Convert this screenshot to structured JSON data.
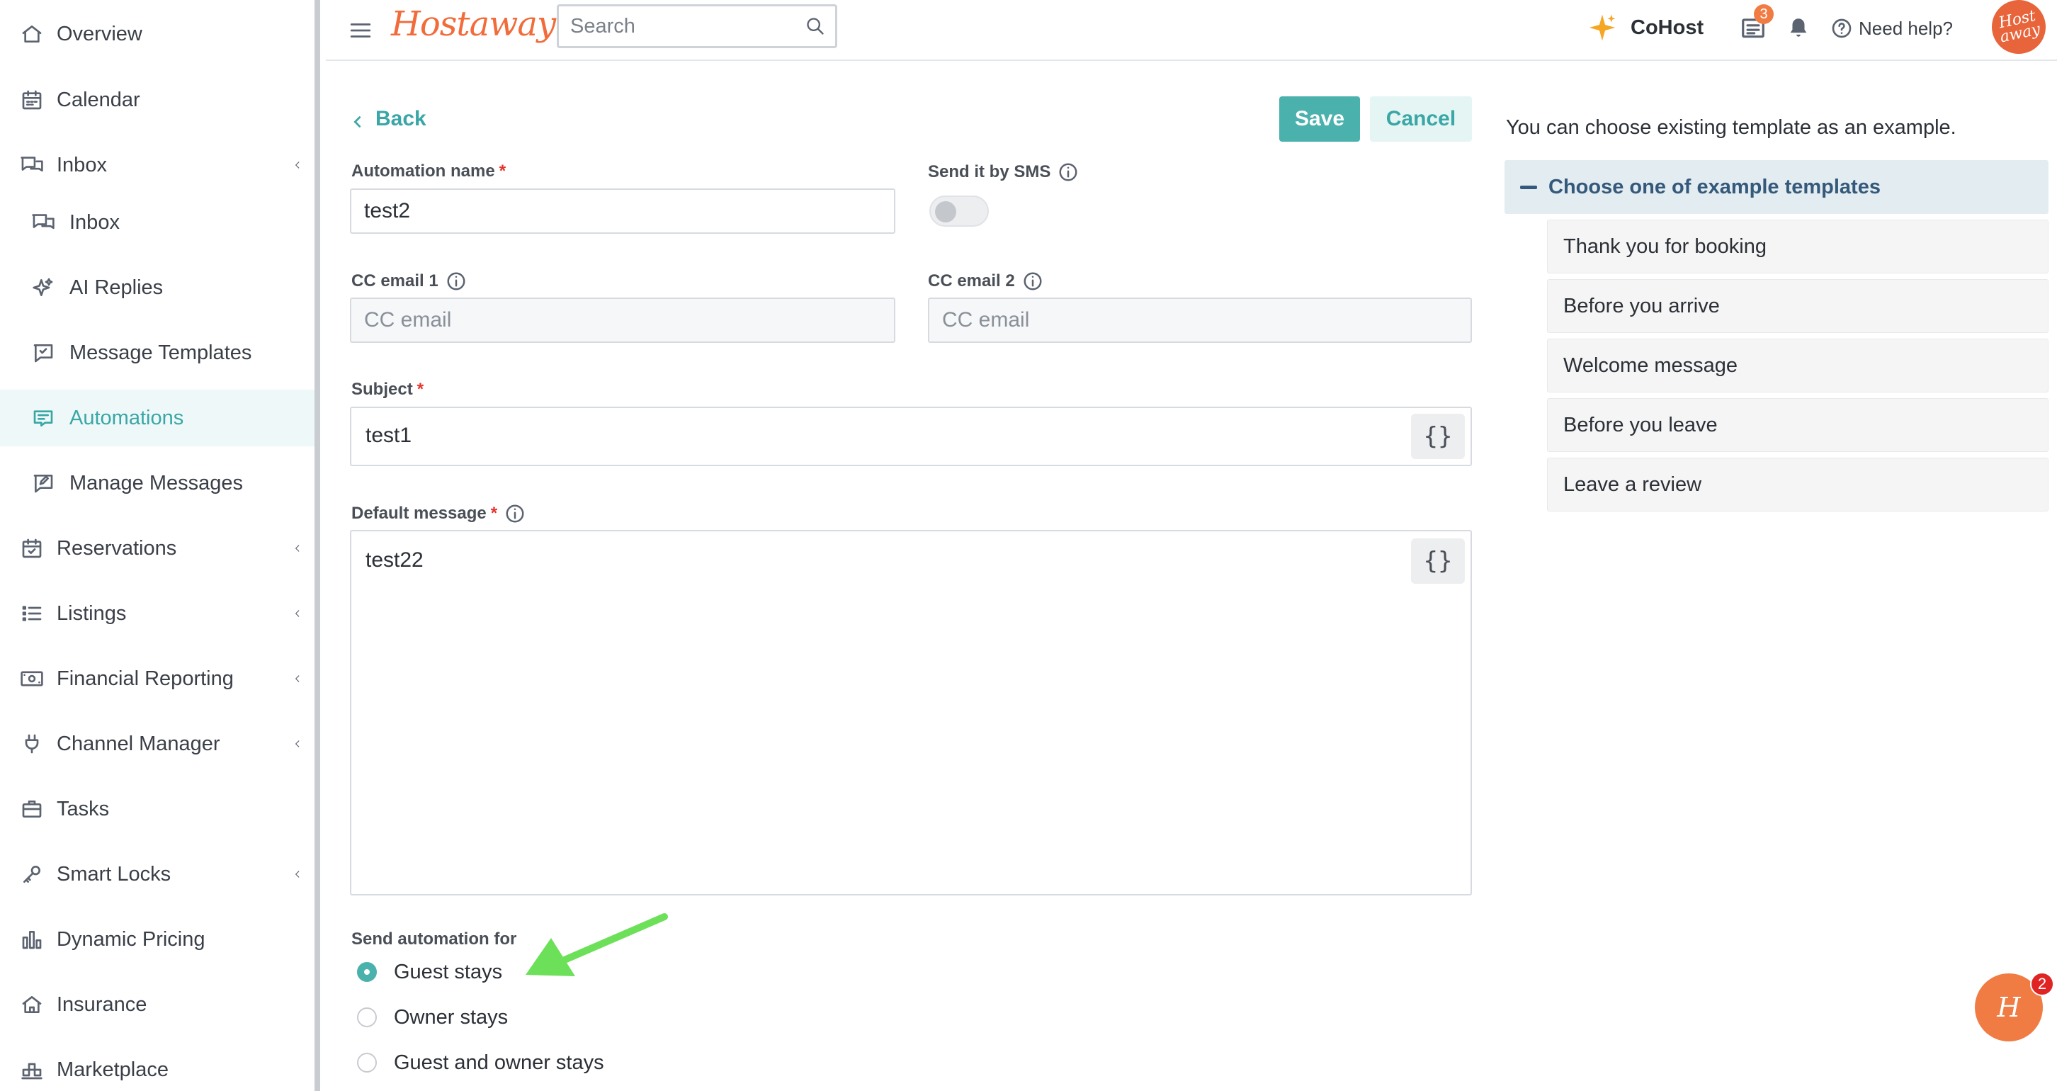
{
  "sidebar": {
    "items": [
      {
        "label": "Overview",
        "icon": "home-icon"
      },
      {
        "label": "Calendar",
        "icon": "calendar-icon"
      },
      {
        "label": "Inbox",
        "icon": "chat-icon"
      },
      {
        "label": "Inbox",
        "icon": "chat-icon"
      },
      {
        "label": "AI Replies",
        "icon": "sparkle-icon"
      },
      {
        "label": "Message Templates",
        "icon": "message-template-icon"
      },
      {
        "label": "Automations",
        "icon": "automation-icon"
      },
      {
        "label": "Manage Messages",
        "icon": "edit-message-icon"
      },
      {
        "label": "Reservations",
        "icon": "calendar-check-icon"
      },
      {
        "label": "Listings",
        "icon": "list-icon"
      },
      {
        "label": "Financial Reporting",
        "icon": "money-icon"
      },
      {
        "label": "Channel Manager",
        "icon": "plug-icon"
      },
      {
        "label": "Tasks",
        "icon": "briefcase-icon"
      },
      {
        "label": "Smart Locks",
        "icon": "key-icon"
      },
      {
        "label": "Dynamic Pricing",
        "icon": "bar-chart-icon"
      },
      {
        "label": "Insurance",
        "icon": "house-shield-icon"
      },
      {
        "label": "Marketplace",
        "icon": "marketplace-icon"
      }
    ],
    "active": "Automations"
  },
  "header": {
    "logo": "Hostaway",
    "search_placeholder": "Search",
    "cohost_label": "CoHost",
    "notifications_count": "3",
    "help_label": "Need help?",
    "avatar_text": "Host away"
  },
  "form": {
    "back_label": "Back",
    "save_label": "Save",
    "cancel_label": "Cancel",
    "automation_name_label": "Automation name",
    "automation_name_value": "test2",
    "required_mark": "*",
    "sms_label": "Send it by SMS",
    "sms_enabled": false,
    "cc1_label": "CC email 1",
    "cc1_placeholder": "CC email",
    "cc2_label": "CC email 2",
    "cc2_placeholder": "CC email",
    "subject_label": "Subject",
    "subject_value": "test1",
    "message_label": "Default message",
    "message_value": "test22",
    "variable_button": "{}",
    "send_for_label": "Send automation for",
    "send_for_options": [
      "Guest stays",
      "Owner stays",
      "Guest and owner stays"
    ],
    "send_for_selected": "Guest stays"
  },
  "templates_panel": {
    "intro": "You can choose existing template as an example.",
    "accordion_title": "Choose one of example templates",
    "templates": [
      "Thank you for booking",
      "Before you arrive",
      "Welcome message",
      "Before you leave",
      "Leave a review"
    ]
  },
  "chat": {
    "label": "H",
    "badge": "2"
  },
  "colors": {
    "accent": "#4ab1ad",
    "brand": "#f26b3a",
    "annotation_arrow": "#6de05a"
  }
}
